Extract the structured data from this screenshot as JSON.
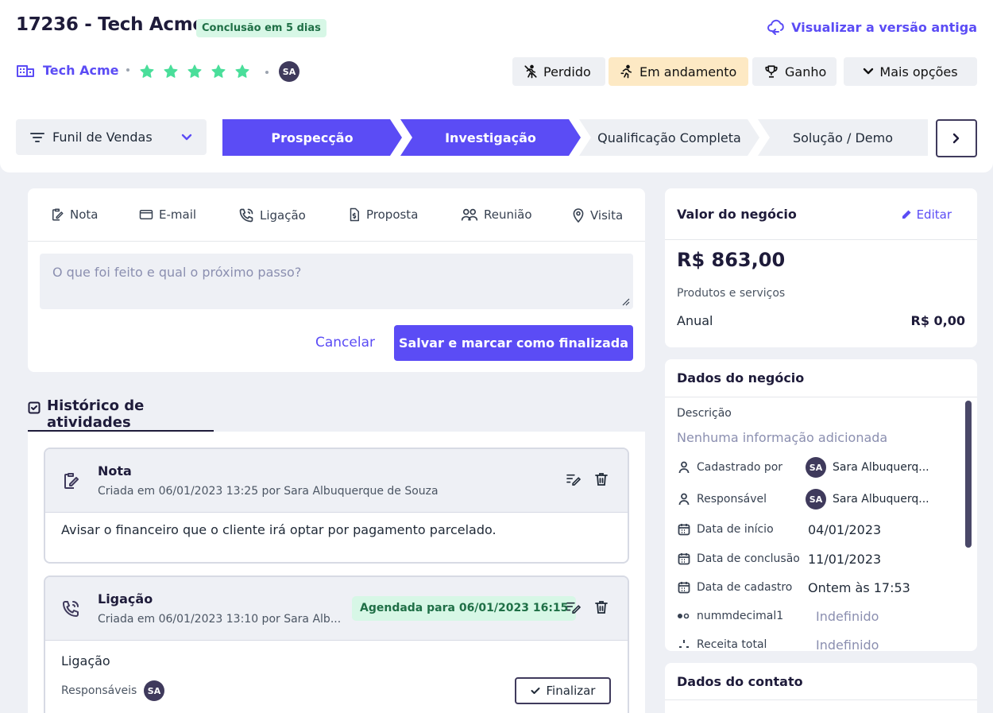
{
  "header": {
    "title": "17236 - Tech Acme",
    "deadline_badge": "Conclusão em 5 dias",
    "old_version_link": "Visualizar a versão antiga",
    "company_link": "Tech Acme",
    "rating_stars": 5,
    "owner_initials": "SA"
  },
  "status_buttons": {
    "lost": "Perdido",
    "in_progress": "Em andamento",
    "won": "Ganho",
    "more": "Mais opções"
  },
  "pipeline": {
    "funnel_label": "Funil de Vendas",
    "stages": [
      {
        "label": "Prospecção",
        "active": true
      },
      {
        "label": "Investigação",
        "active": true
      },
      {
        "label": "Qualificação Completa",
        "active": false
      },
      {
        "label": "Solução / Demo",
        "active": false
      }
    ]
  },
  "composer": {
    "tabs": [
      "Nota",
      "E-mail",
      "Ligação",
      "Proposta",
      "Reunião",
      "Visita"
    ],
    "placeholder": "O que foi feito e qual o próximo passo?",
    "cancel_label": "Cancelar",
    "save_label": "Salvar e marcar como finalizada"
  },
  "history": {
    "tab_label": "Histórico de atividades",
    "items": [
      {
        "type": "Nota",
        "meta": "Criada em 06/01/2023 13:25 por Sara Albuquerque de Souza",
        "body": "Avisar o financeiro que o cliente irá optar por pagamento parcelado."
      },
      {
        "type": "Ligação",
        "meta": "Criada em 06/01/2023 13:10 por Sara Alb...",
        "schedule_badge": "Agendada para 06/01/2023 16:15",
        "body": "Ligação",
        "responsibles_label": "Responsáveis",
        "responsible_initials": "SA",
        "finish_label": "Finalizar"
      }
    ]
  },
  "deal_value": {
    "title": "Valor do negócio",
    "edit_label": "Editar",
    "amount": "R$ 863,00",
    "products_label": "Produtos e serviços",
    "annual_label": "Anual",
    "annual_value": "R$ 0,00"
  },
  "deal_data": {
    "title": "Dados do negócio",
    "description_label": "Descrição",
    "description_value": "Nenhuma informação adicionada",
    "fields": [
      {
        "label": "Cadastrado por",
        "initials": "SA",
        "value": "Sara Albuquerq..."
      },
      {
        "label": "Responsável",
        "initials": "SA",
        "value": "Sara Albuquerq..."
      },
      {
        "label": "Data de início",
        "value": "04/01/2023"
      },
      {
        "label": "Data de conclusão",
        "value": "11/01/2023"
      },
      {
        "label": "Data de cadastro",
        "value": "Ontem às 17:53"
      },
      {
        "label": "nummdecimal1",
        "value": "Indefinido"
      },
      {
        "label": "Receita total",
        "value": "Indefinido"
      }
    ]
  },
  "contact_data": {
    "title": "Dados do contato"
  },
  "colors": {
    "accent": "#5b4cf5",
    "star": "#4ade9a",
    "badge_green_bg": "#d7f7e6",
    "in_progress_bg": "#fde9c4",
    "dark": "#1e1b3a"
  }
}
